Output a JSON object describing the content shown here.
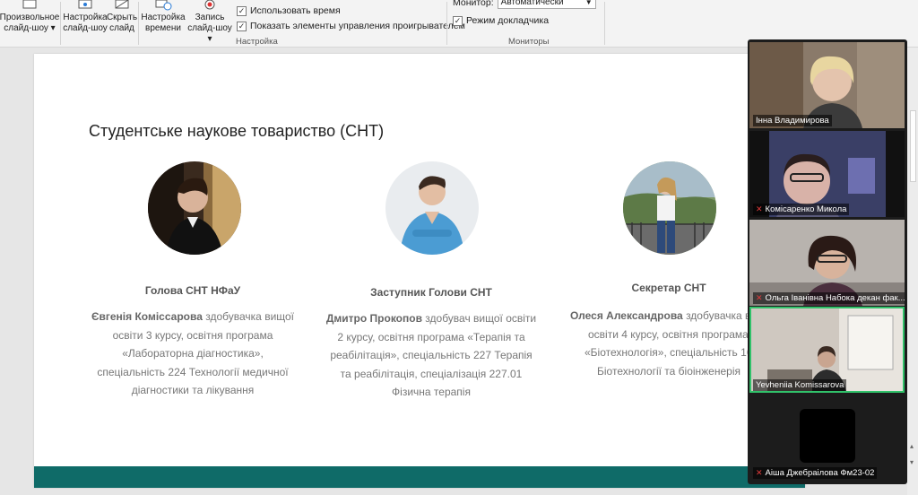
{
  "ribbon": {
    "custom_show_label": "Произвольное",
    "custom_show_label2": "слайд-шоу",
    "setup_show_label": "Настройка",
    "setup_show_label2": "слайд-шоу",
    "hide_slide_label": "Скрыть",
    "hide_slide_label2": "слайд",
    "rehearse_label": "Настройка",
    "rehearse_label2": "времени",
    "record_label": "Запись",
    "record_label2": "слайд-шоу",
    "use_timings": "Использовать время",
    "show_media_controls": "Показать элементы управления проигрывателем",
    "group_setup": "Настройка",
    "monitor_label": "Монитор:",
    "monitor_value": "Автоматически",
    "presenter_view": "Режим докладчика",
    "group_monitors": "Мониторы"
  },
  "slide": {
    "title": "Студентське наукове товариство (СНТ)",
    "members": [
      {
        "role": "Голова СНТ НФаУ",
        "name": "Євгенія Коміссарова",
        "lines": [
          " здобувачка вищої",
          "освіти 3 курсу, освітня програма",
          "«Лабораторна діагностика»,",
          "спеціальність 224 Технології медичної",
          "діагностики та лікування"
        ]
      },
      {
        "role": "Заступник Голови СНТ",
        "name": "Дмитро Прокопов",
        "lines": [
          " здобувач вищої освіти",
          "2 курсу, освітня програма «Терапія та",
          "реабілітація», спеціальність 227 Терапія",
          "та реабілітація, спеціалізація 227.01",
          "Фізична терапія"
        ]
      },
      {
        "role": "Секретар СНТ",
        "name": "Олеся Александрова",
        "lines": [
          " здобувачка ві",
          "освіти 4 курсу, освітня програма",
          "«Біотехнологія», спеціальність 16",
          "Біотехнології та біоінженерія"
        ]
      }
    ]
  },
  "zoom": {
    "participants": [
      {
        "name": "Інна Владимирова",
        "muted": false
      },
      {
        "name": "Комісаренко Микола",
        "muted": true
      },
      {
        "name": "Ольга Іванівна Набока декан фак...",
        "muted": true
      },
      {
        "name": "Yevheniia Komissarova",
        "muted": false
      },
      {
        "name": "Аіша Джебраілова Фм23-02",
        "muted": true
      }
    ]
  },
  "colors": {
    "footer_bar": "#0f6b68",
    "active_speaker": "#31c26a",
    "muted_icon": "#e23b3b"
  }
}
